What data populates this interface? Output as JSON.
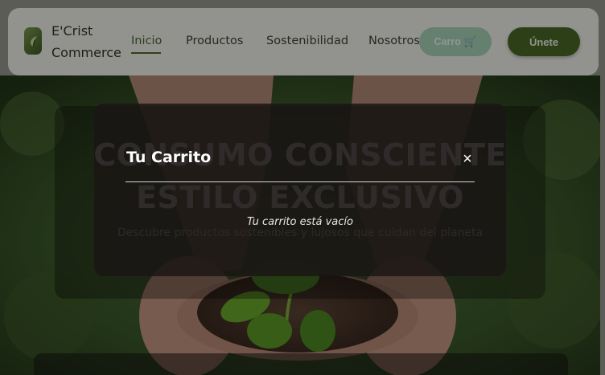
{
  "header": {
    "brand_line1": "E'Crist",
    "brand_line2": "Commerce",
    "nav": [
      {
        "label": "Inicio",
        "active": true
      },
      {
        "label": "Productos"
      },
      {
        "label": "Sostenibilidad"
      },
      {
        "label": "Nosotros"
      }
    ],
    "cart_label": "Carro",
    "cart_icon": "🛒",
    "join_label": "Únete"
  },
  "hero": {
    "title_line1": "CONSUMO CONSCIENTE",
    "title_line2": "ESTILO EXCLUSIVO",
    "subtitle": "Descubre productos sostenibles y lujosos que cuidan del planeta"
  },
  "cart_modal": {
    "title": "Tu Carrito",
    "close_glyph": "×",
    "empty_message": "Tu carrito está vacío"
  },
  "colors": {
    "brand_green": "#4a6a25",
    "cart_button": "#a8d6b7",
    "header_bg": "#f3f3ee"
  }
}
